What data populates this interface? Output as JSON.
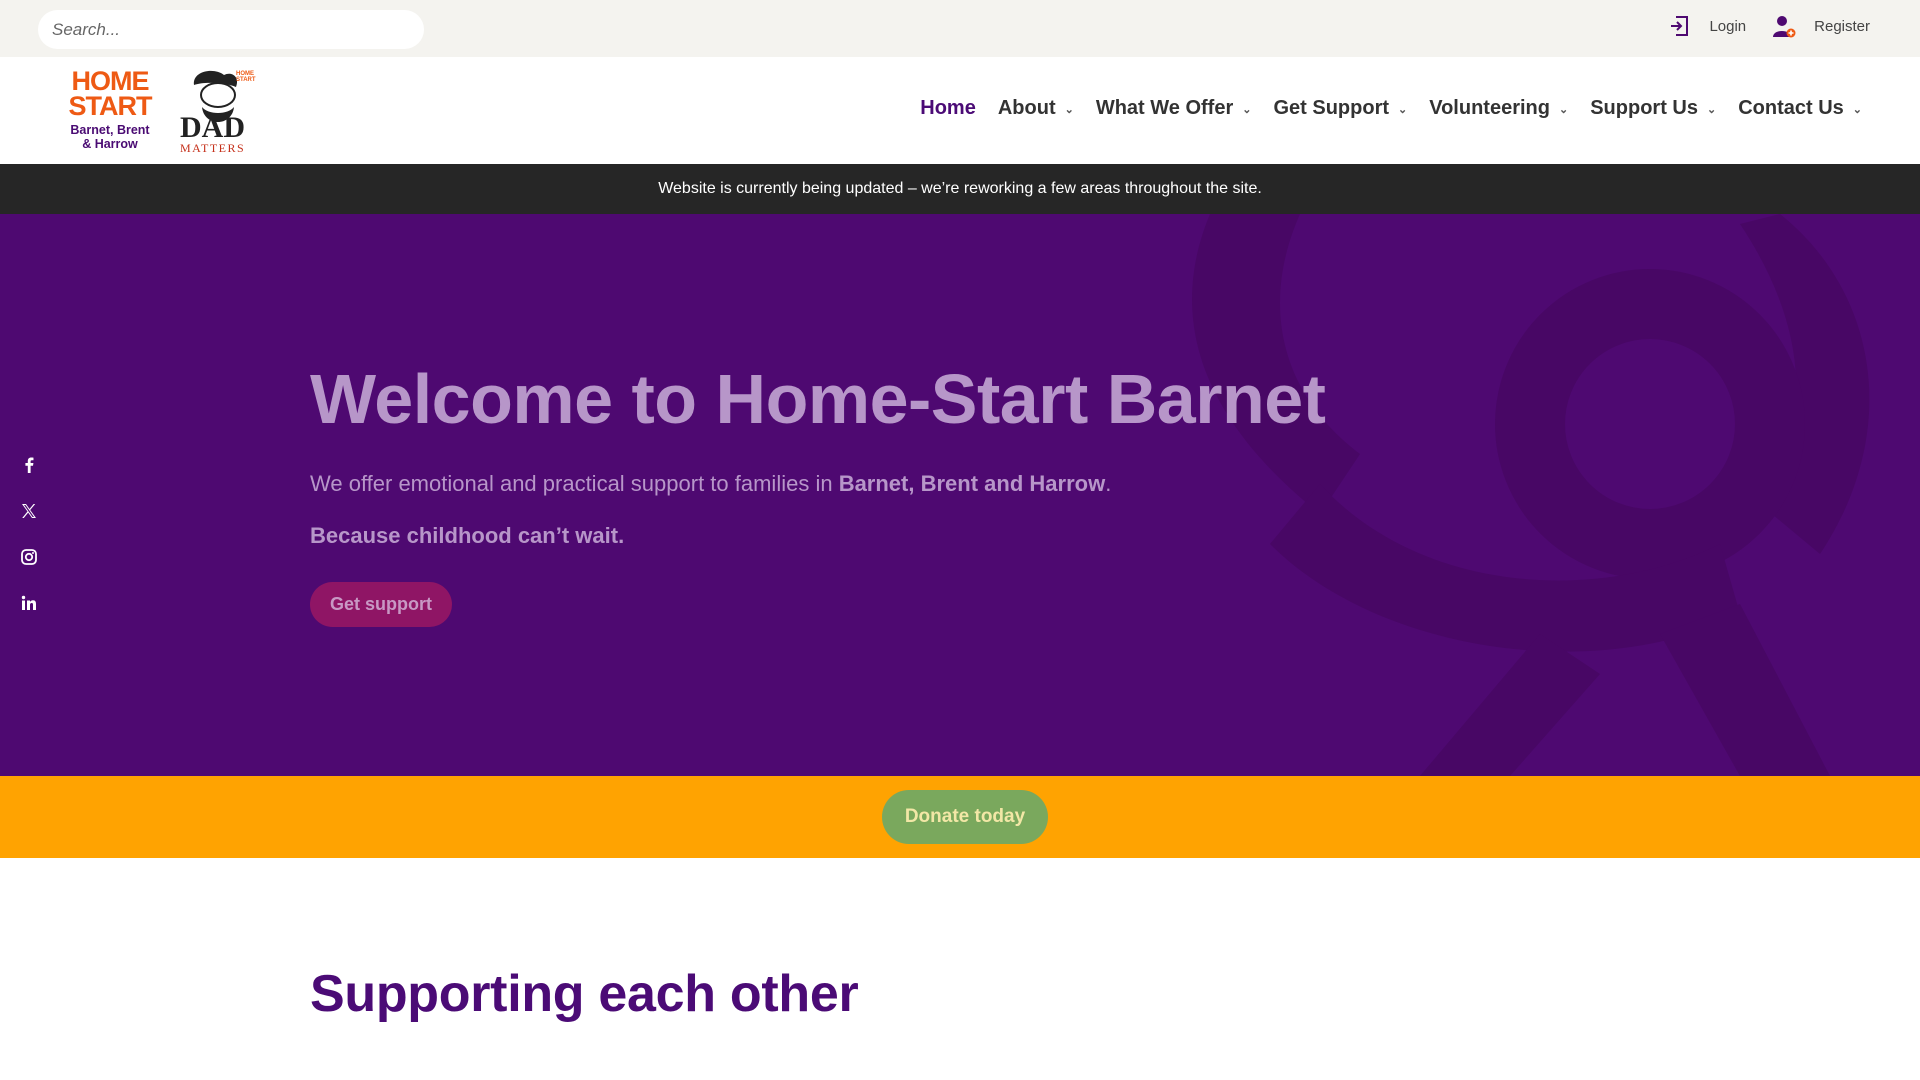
{
  "topbar": {
    "search_placeholder": "Search...",
    "login_label": "Login",
    "register_label": "Register"
  },
  "logo": {
    "homestart_line1": "HOME",
    "homestart_line2": "START",
    "homestart_line3": "Barnet, Brent",
    "homestart_line4": "& Harrow",
    "dad_text": "DAD",
    "dad_matters": "MATTERS",
    "dad_badge": "HOME START"
  },
  "nav": {
    "items": [
      {
        "label": "Home",
        "active": true,
        "has_dropdown": false
      },
      {
        "label": "About",
        "active": false,
        "has_dropdown": true
      },
      {
        "label": "What We Offer",
        "active": false,
        "has_dropdown": true
      },
      {
        "label": "Get Support",
        "active": false,
        "has_dropdown": true
      },
      {
        "label": "Volunteering",
        "active": false,
        "has_dropdown": true
      },
      {
        "label": "Support Us",
        "active": false,
        "has_dropdown": true
      },
      {
        "label": "Contact Us",
        "active": false,
        "has_dropdown": true
      }
    ]
  },
  "notice": {
    "text": "Website is currently being updated – we’re reworking a few areas throughout the site."
  },
  "hero": {
    "title": "Welcome to Home-Start Barnet",
    "subtitle_prefix": "We offer emotional and practical support to families in ",
    "subtitle_bold": "Barnet, Brent and Harrow",
    "subtitle_suffix": ".",
    "tagline": "Because childhood can’t wait.",
    "cta_label": "Get support"
  },
  "social": {
    "icons": [
      "facebook-icon",
      "x-twitter-icon",
      "instagram-icon",
      "linkedin-icon"
    ]
  },
  "donate": {
    "label": "Donate today"
  },
  "section": {
    "title": "Supporting each other"
  },
  "colors": {
    "brand_purple": "#4e0971",
    "brand_orange": "#ee5a14",
    "donate_band": "#ffa301",
    "donate_button": "#7aa85d",
    "support_button": "#8f1565",
    "notice_bar": "#262626"
  }
}
